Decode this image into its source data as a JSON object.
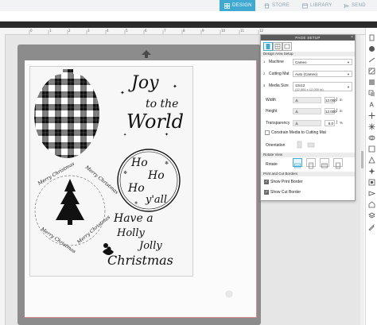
{
  "nav": {
    "tabs": [
      {
        "label": "DESIGN",
        "icon": "grid-icon"
      },
      {
        "label": "STORE",
        "icon": "store-icon"
      },
      {
        "label": "LIBRARY",
        "icon": "library-icon"
      },
      {
        "label": "SEND",
        "icon": "send-icon"
      }
    ],
    "active_tab": "DESIGN",
    "accent": "#3fa9d2"
  },
  "ruler": {
    "ticks": [
      "0",
      "1",
      "2",
      "3",
      "4",
      "5",
      "6",
      "7",
      "8",
      "9",
      "10",
      "11",
      "12"
    ]
  },
  "designs": [
    {
      "text": "Joy to the World"
    },
    {
      "text": "Ho Ho Ho y'all"
    },
    {
      "text": "Merry Christmas"
    },
    {
      "text": "Have a Holly Jolly Christmas"
    }
  ],
  "page_setup": {
    "title": "PAGE SETUP",
    "close": "×",
    "section_design_area": "Design Area Setup",
    "machine_label": "Machine",
    "machine_value": "Cameo",
    "cutting_mat_label": "Cutting Mat",
    "cutting_mat_value": "Auto (Cameo)",
    "media_size_label": "Media Size",
    "media_size_value": "12x12",
    "media_size_detail": "(12.000 x 12.000 in)",
    "width_label": "Width",
    "width_value": "12.000",
    "height_label": "Height",
    "height_value": "12.000",
    "transparency_label": "Transparency",
    "transparency_value": "8.0",
    "unit_in": "in",
    "unit_percent": "%",
    "constrain_label": "Constrain Media to Cutting Mat",
    "constrain_checked": false,
    "orientation_label": "Orientation",
    "section_rotate_view": "Rotate View",
    "rotate_label": "Rotate",
    "section_borders": "Print and Cut Borders",
    "show_print_border_label": "Show Print Border",
    "show_print_border_checked": true,
    "show_cut_border_label": "Show Cut Border",
    "show_cut_border_checked": true,
    "step1": "1",
    "step2": "2",
    "step3": "3"
  },
  "right_toolbar": {
    "icons": [
      "page-setup-icon",
      "fill-icon",
      "line-style-icon",
      "fill-pattern-icon",
      "gradient-icon",
      "shadow-icon",
      "text-style-icon",
      "transform-icon",
      "replicate-icon",
      "modify-icon",
      "offset-icon",
      "trace-icon",
      "nesting-icon",
      "print-cut-icon",
      "send-icon",
      "library-panel-icon",
      "layers-icon",
      "sketch-icon"
    ]
  }
}
